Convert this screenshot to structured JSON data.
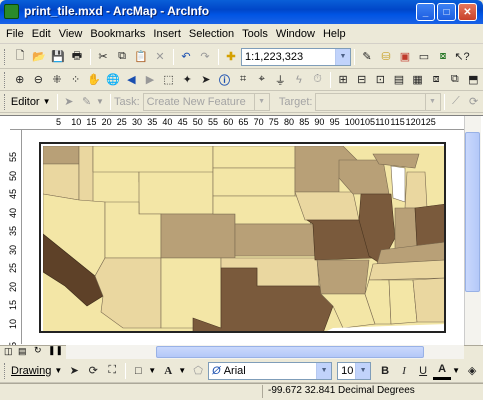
{
  "window": {
    "title": "print_tile.mxd - ArcMap - ArcInfo"
  },
  "menu": [
    "File",
    "Edit",
    "View",
    "Bookmarks",
    "Insert",
    "Selection",
    "Tools",
    "Window",
    "Help"
  ],
  "standard_toolbar": {
    "scale_value": "1:1,223,323"
  },
  "editor_toolbar": {
    "editor_label": "Editor",
    "task_label": "Task:",
    "task_value": "Create New Feature",
    "target_label": "Target:",
    "target_value": ""
  },
  "ruler": {
    "top_ticks": [
      "5",
      "10",
      "15",
      "20",
      "25",
      "30",
      "35",
      "40",
      "45",
      "50",
      "55",
      "60",
      "65",
      "70",
      "75",
      "80",
      "85",
      "90",
      "95",
      "100",
      "105",
      "110",
      "115",
      "120",
      "125"
    ],
    "left_ticks": [
      "55",
      "50",
      "45",
      "40",
      "35",
      "30",
      "25",
      "20",
      "15",
      "10",
      "5"
    ]
  },
  "draw_toolbar": {
    "drawing_label": "Drawing",
    "font_name": "Arial",
    "font_size": "10",
    "bold": "B",
    "italic": "I",
    "underline": "U"
  },
  "status": {
    "coordinates": "-99.672  32.841 Decimal Degrees"
  },
  "colors": {
    "light": "#f3e6a6",
    "pale": "#ead7a0",
    "medium": "#b8a077",
    "dark": "#7a5a3c",
    "darkest": "#5e4128",
    "water": "#ffffff"
  }
}
